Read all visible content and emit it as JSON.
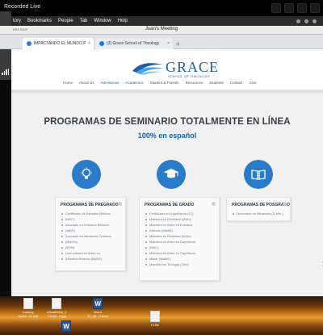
{
  "recording": {
    "label": "Recorded Live"
  },
  "left_panel": {
    "label": "ial"
  },
  "menu_bar": {
    "items": [
      "tory",
      "Bookmarks",
      "People",
      "Tab",
      "Window",
      "Help"
    ]
  },
  "zoom": {
    "meeting_title": "Juan's Meeting",
    "left_tag": "ERY EXIT"
  },
  "browser": {
    "tabs": [
      {
        "label": "IMPACTANDO EL MUNDO PA",
        "close": "×",
        "favicon_color": "#3a7bd5"
      },
      {
        "label": "(3) Grace School of Theology",
        "close": "×",
        "favicon_color": "#1877f2"
      }
    ],
    "new_tab": "+"
  },
  "site": {
    "logo_word": "GRACE",
    "logo_sub": "SCHOOL OF THEOLOGY",
    "nav": [
      "Home",
      "About Us",
      "Admissions",
      "Academics",
      "Student & Friends",
      "Resources",
      "Students",
      "Contact",
      "Give"
    ],
    "nav_active_index": 2,
    "headline": "PROGRAMAS DE SEMINARIO TOTALMENTE EN LÍNEA",
    "subheadline": "100% en español",
    "brand_color": "#1d5ea8",
    "icon_color": "#2a7bc8",
    "cards": [
      {
        "title": "PROGRAMAS DE PREGRADO",
        "icon": "lightbulb-icon",
        "items": [
          "Certificado de Estudios Bíblicos",
          "(BIST)",
          "Asociado en Estudios Bíblicos",
          "(AIBS)",
          "Asociado en Ministerio Cristiano",
          "(BMCM)",
          "(BTM)",
          "Licenciatura en Artes en",
          "Estudios Bíblicos (BABS)"
        ]
      },
      {
        "title": "PROGRAMAS DE GRADO",
        "icon": "graduation-cap-icon",
        "items": [
          "Certificado en Capellanía (CC)",
          "Maestría en Divinidad (MDiv)",
          "Maestría en Artes en Estudios",
          "Bíblicos (MABS)",
          "Maestría en Divinidad (MDiv)",
          "Maestría en Artes en Capellanía",
          "(MAC)",
          "Maestría en Artes en Capellanía",
          "Militar (MAMC)",
          "Maestría en Teología (ThM)"
        ]
      },
      {
        "title": "PROGRAMAS DE POSGRADO",
        "icon": "book-icon",
        "items": [
          "Doctorado en Ministerio (D.Min.)"
        ]
      }
    ]
  },
  "desktop": {
    "items": [
      {
        "name": "Catalog",
        "caption": "Catalog\nUpdat...21.pdf",
        "kind": "pdf"
      },
      {
        "name": "file-1",
        "caption": "e9ba82808_2\n74046...e.jpg",
        "kind": "image"
      },
      {
        "name": "word-doc",
        "caption": "",
        "kind": "word"
      },
      {
        "name": "Word-file",
        "caption": "Word\n30_08...2.docx",
        "kind": "word"
      },
      {
        "name": "Hi file",
        "caption": "Hi file",
        "kind": "doc"
      }
    ]
  }
}
